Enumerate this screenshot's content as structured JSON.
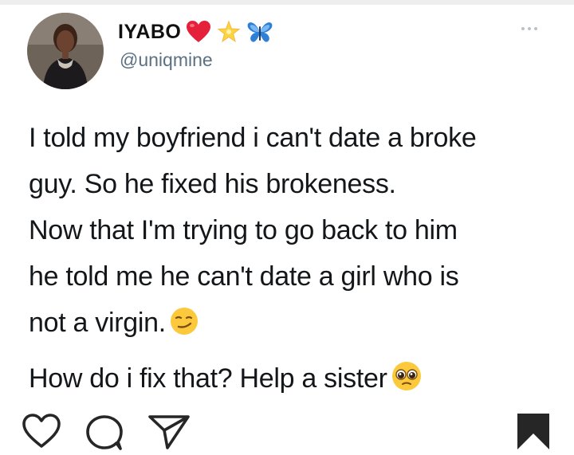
{
  "tweet": {
    "author": {
      "display_name": "IYABO",
      "name_emojis": [
        "red-heart",
        "glowing-star",
        "butterfly"
      ],
      "handle": "@uniqmine"
    },
    "lines": [
      "I told my boyfriend i can't date a broke",
      "guy. So he fixed his brokeness.",
      "Now that I'm trying to go back to him",
      "he told me he can't date a girl who is",
      "not a virgin."
    ],
    "line_end_emoji": "smirking-face",
    "closing_line": "How do i fix that?  Help a sister",
    "closing_emoji": "pleading-face"
  },
  "actions": {
    "like_icon": "heart-outline-icon",
    "comment_icon": "speech-bubble-icon",
    "share_icon": "paper-plane-icon",
    "save_icon": "bookmark-filled-icon"
  },
  "colors": {
    "text": "#14171a",
    "handle": "#5b7083",
    "icon": "#262626"
  }
}
